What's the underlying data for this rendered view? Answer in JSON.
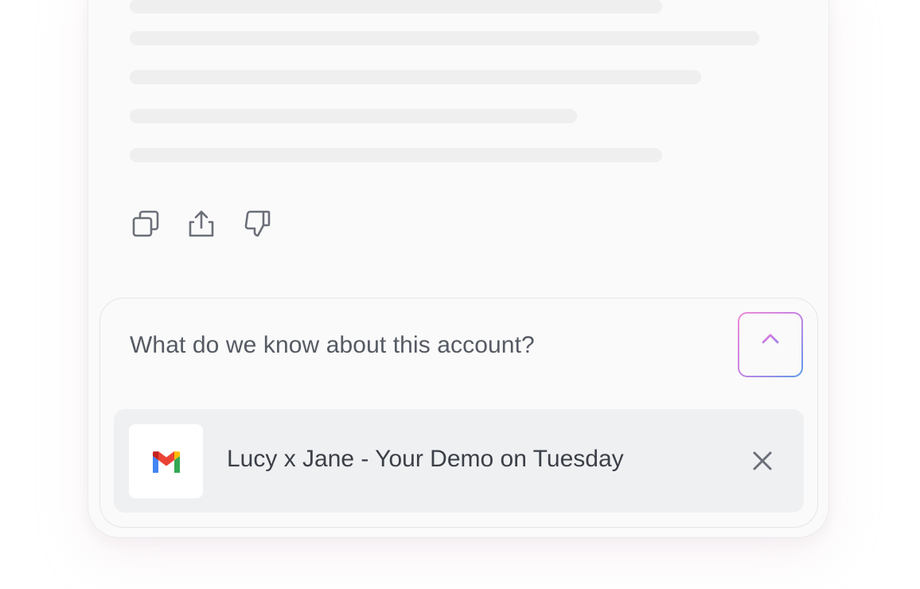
{
  "message": {
    "actions": [
      {
        "icon": "copy-icon"
      },
      {
        "icon": "share-icon"
      },
      {
        "icon": "thumbs-down-icon"
      }
    ]
  },
  "composer": {
    "prompt": "What do we know about this account?",
    "send_icon": "arrow-up-icon"
  },
  "attachment": {
    "icon": "gmail-icon",
    "title": "Lucy x Jane - Your Demo on Tuesday",
    "remove_icon": "close-icon"
  },
  "colors": {
    "card_background": "#fafafa",
    "skeleton": "#efefef",
    "icon": "#6b6f78",
    "attachment_background": "#eff0f2",
    "send_gradient_start": "#ec8ad6",
    "send_gradient_end": "#5a9be8"
  }
}
